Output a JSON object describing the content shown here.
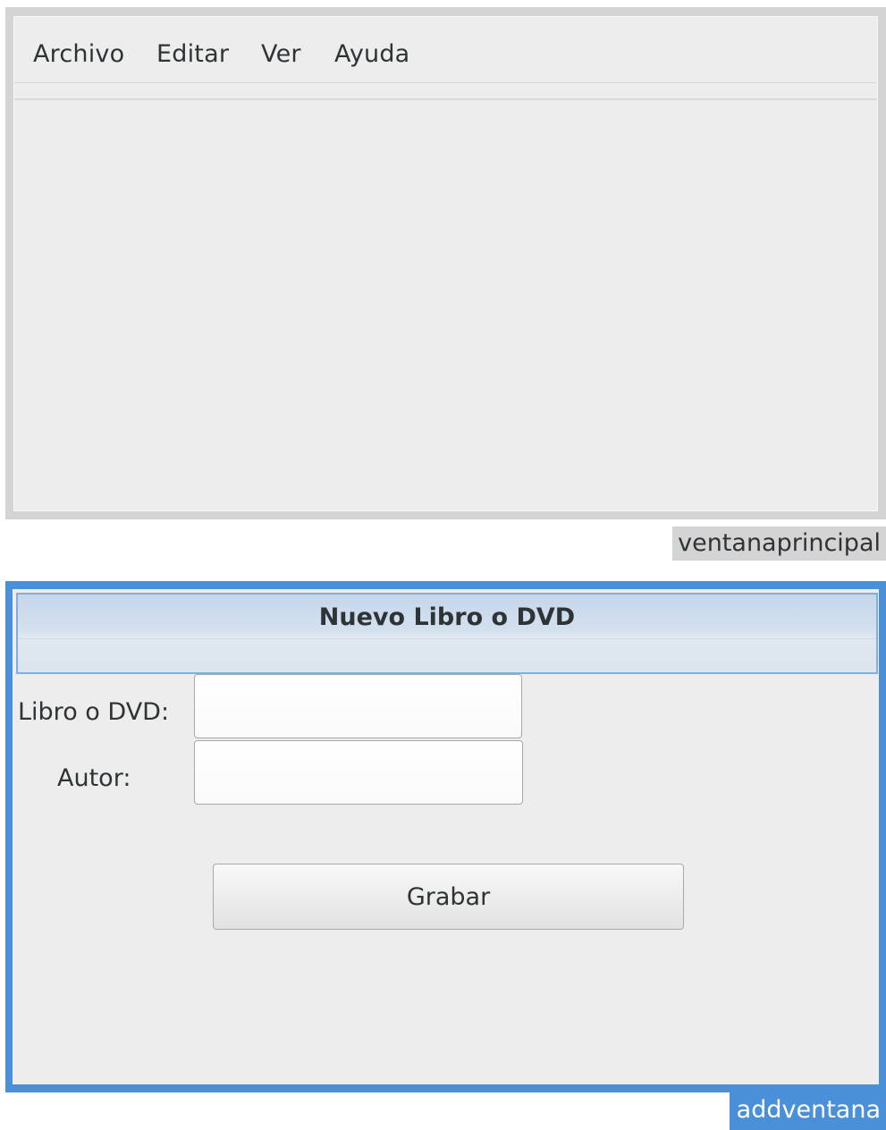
{
  "main_window": {
    "name_tag": "ventanaprincipal",
    "menu": {
      "items": [
        {
          "label": "Archivo"
        },
        {
          "label": "Editar"
        },
        {
          "label": "Ver"
        },
        {
          "label": "Ayuda"
        }
      ]
    }
  },
  "add_window": {
    "name_tag": "addventana",
    "title": "Nuevo Libro o DVD",
    "fields": {
      "item": {
        "label": "Libro o DVD:",
        "value": ""
      },
      "author": {
        "label": "Autor:",
        "value": ""
      }
    },
    "save_button": {
      "label": "Grabar"
    }
  },
  "colors": {
    "window_bg": "#ededed",
    "frame_gray": "#d4d4d4",
    "accent_blue": "#4a90d9",
    "text": "#2e3436"
  }
}
